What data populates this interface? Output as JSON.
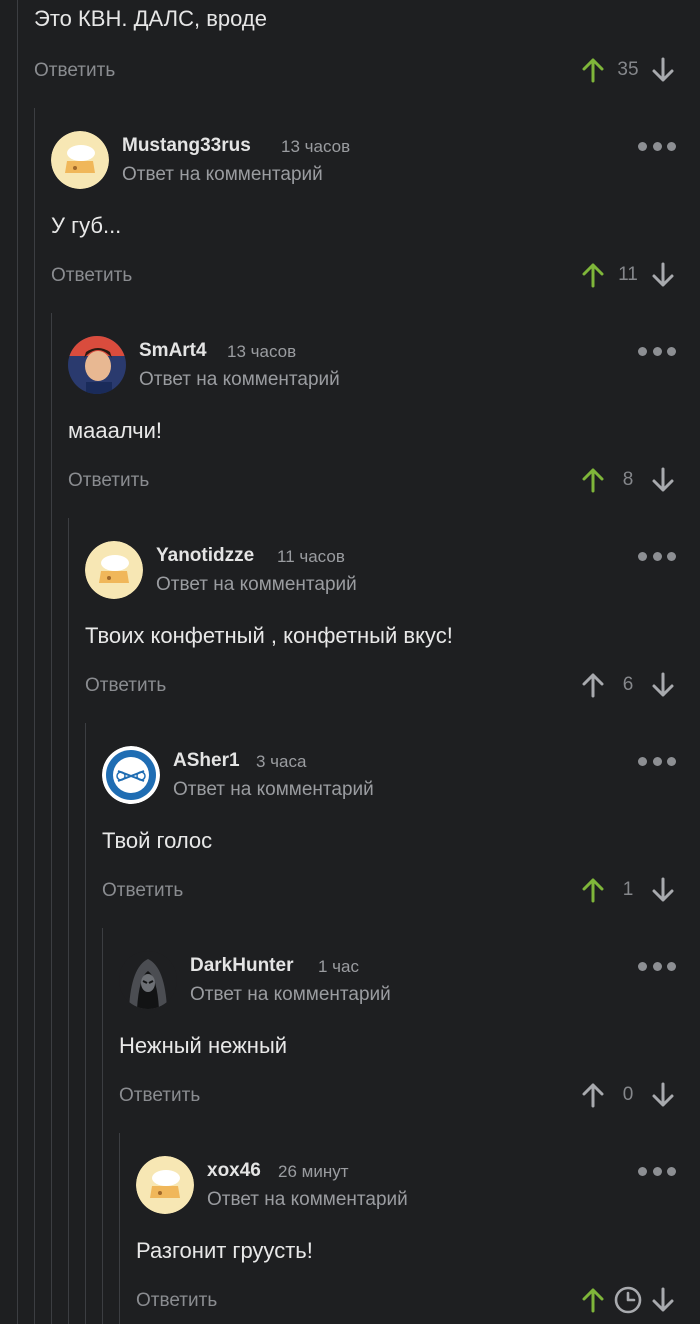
{
  "top_comment": {
    "text": "Это КВН. ДАЛС, вроде",
    "reply_label": "Ответить",
    "rating": "35"
  },
  "reply_subtitle": "Ответ на комментарий",
  "colors": {
    "upvoted": "#7fb63a",
    "neutral": "#a8aaae",
    "line": "#3c3e42"
  },
  "comments": [
    {
      "username": "Mustang33rus",
      "time": "13 часов",
      "subtitle": "Ответ на комментарий",
      "text": "У губ...",
      "reply_label": "Ответить",
      "rating": "11",
      "upvoted": true,
      "avatar": "default-avatar"
    },
    {
      "username": "SmArt4",
      "time": "13 часов",
      "subtitle": "Ответ на комментарий",
      "text": "мааалчи!",
      "reply_label": "Ответить",
      "rating": "8",
      "upvoted": true,
      "avatar": "photo-avatar"
    },
    {
      "username": "Yanotidzze",
      "time": "11 часов",
      "subtitle": "Ответ на комментарий",
      "text": "Твоих конфетный , конфетный вкус!",
      "reply_label": "Ответить",
      "rating": "6",
      "upvoted": false,
      "avatar": "default-avatar"
    },
    {
      "username": "ASher1",
      "time": "3 часа",
      "subtitle": "Ответ на комментарий",
      "text": "Твой голос",
      "reply_label": "Ответить",
      "rating": "1",
      "upvoted": true,
      "avatar": "bike-logo-avatar"
    },
    {
      "username": "DarkHunter",
      "time": "1 час",
      "subtitle": "Ответ на комментарий",
      "text": "Нежный нежный",
      "reply_label": "Ответить",
      "rating": "0",
      "upvoted": false,
      "avatar": "hooded-figure-avatar"
    },
    {
      "username": "xox46",
      "time": "26 минут",
      "subtitle": "Ответ на комментарий",
      "text": "Разгонит груусть!",
      "reply_label": "Ответить",
      "rating": "",
      "upvoted": true,
      "pending": true,
      "avatar": "default-avatar"
    }
  ]
}
